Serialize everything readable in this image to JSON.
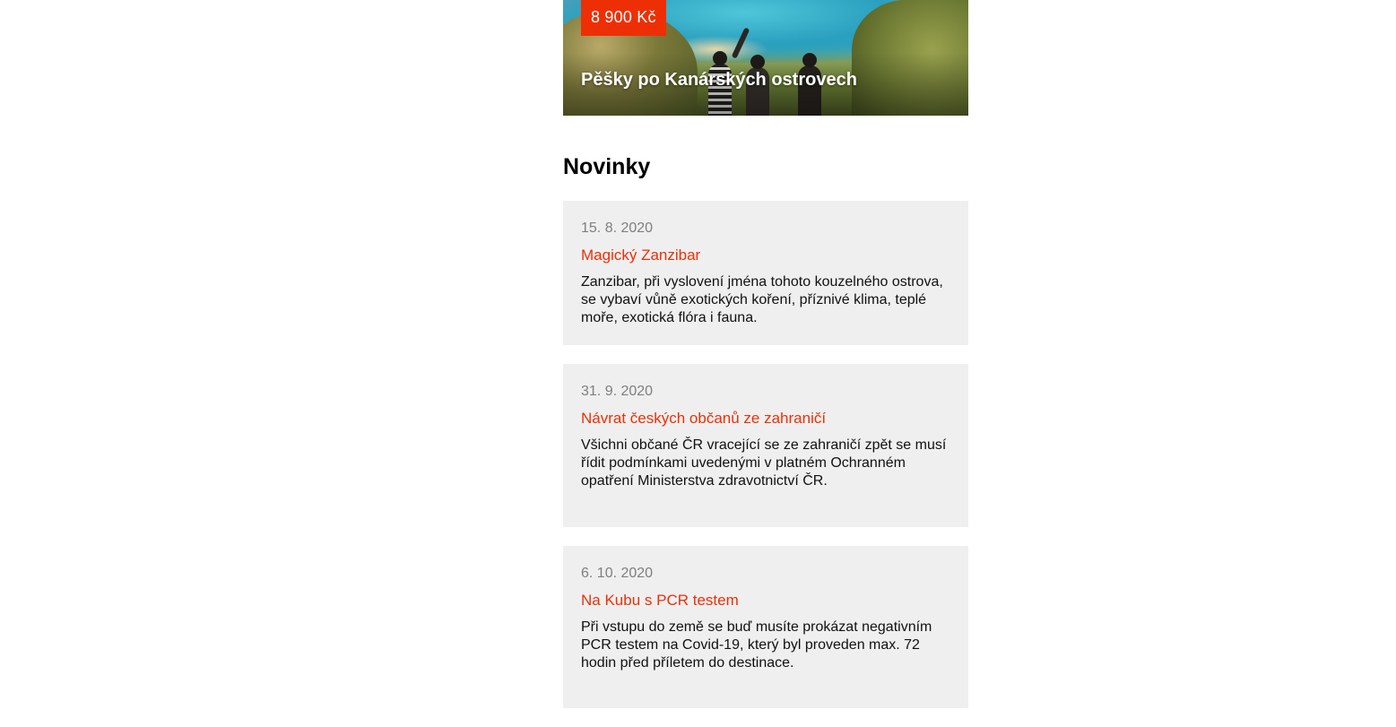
{
  "promo": {
    "price": "8 900 Kč",
    "title": "Pěšky po Kanárských ostrovech"
  },
  "news": {
    "heading": "Novinky",
    "items": [
      {
        "date": "15. 8. 2020",
        "title": "Magický Zanzibar",
        "text": "Zanzibar, při vyslovení jména tohoto kouzelného ostrova, se vybaví vůně exotických koření, příznivé klima, teplé moře, exotická flóra i fauna."
      },
      {
        "date": "31. 9. 2020",
        "title": "Návrat českých občanů ze zahraničí",
        "text": "Všichni občané ČR vracející se ze zahraničí zpět se musí řídit podmínkami uvedenými v platném Ochranném opatření Ministerstva zdravotnictví ČR."
      },
      {
        "date": "6. 10. 2020",
        "title": "Na Kubu s PCR testem",
        "text": "Při vstupu do země se buď musíte prokázat negativním PCR testem na Covid-19, který byl proveden max. 72 hodin před příletem do destinace."
      }
    ]
  },
  "colors": {
    "accent": "#ee2f06",
    "card_background": "#efefef",
    "date_text": "#7f7f7f"
  }
}
